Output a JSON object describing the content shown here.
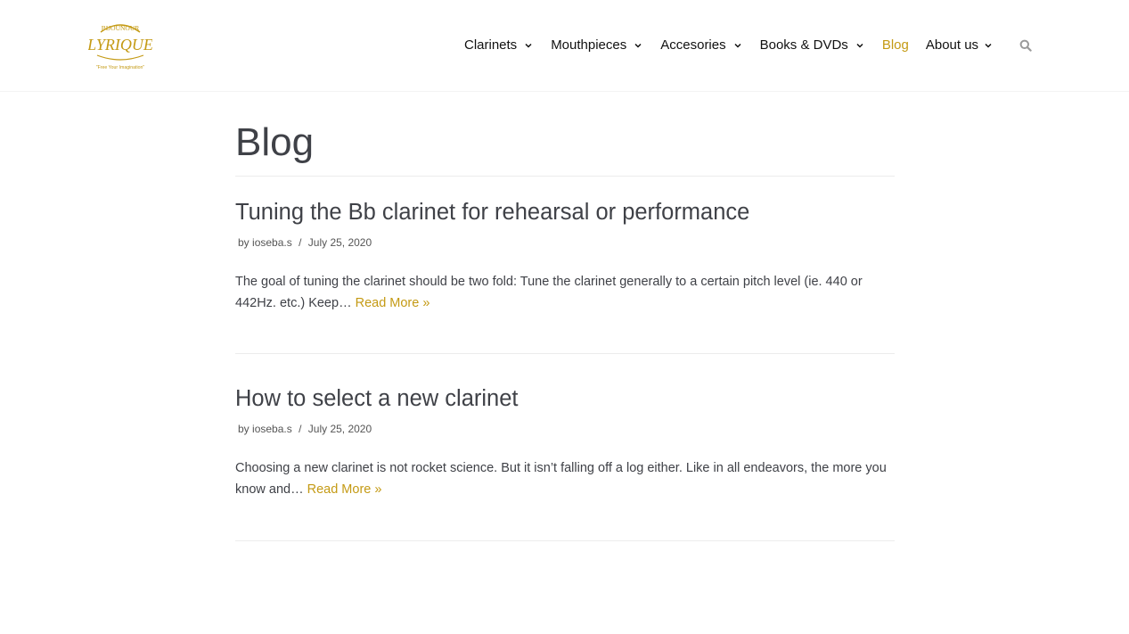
{
  "brand": {
    "logo_top": "BIJOUNOUR",
    "logo_main": "LYRIQUE",
    "tagline": "\"Free Your Imagination\"",
    "accent_color": "#c49a14"
  },
  "nav": {
    "items": [
      {
        "label": "Clarinets",
        "has_dropdown": true
      },
      {
        "label": "Mouthpieces",
        "has_dropdown": true
      },
      {
        "label": "Accesories",
        "has_dropdown": true
      },
      {
        "label": "Books & DVDs",
        "has_dropdown": true
      },
      {
        "label": "Blog",
        "has_dropdown": false,
        "active": true
      },
      {
        "label": "About us",
        "has_dropdown": true
      }
    ],
    "search_icon": "search-icon"
  },
  "page": {
    "title": "Blog"
  },
  "posts": [
    {
      "title": "Tuning the Bb clarinet for rehearsal or performance",
      "by": "by",
      "author": "ioseba.s",
      "sep": "/",
      "date": "July 25, 2020",
      "excerpt": "The goal of tuning the clarinet should be two fold: Tune the clarinet generally to a certain pitch level (ie. 440 or 442Hz. etc.) Keep… ",
      "read_more": "Read More »"
    },
    {
      "title": "How to select a new clarinet",
      "by": "by",
      "author": "ioseba.s",
      "sep": "/",
      "date": "July 25, 2020",
      "excerpt": "Choosing a new clarinet is not rocket science.  But it isn’t falling off a log either.  Like in all endeavors, the more you know and… ",
      "read_more": "Read More »"
    }
  ]
}
